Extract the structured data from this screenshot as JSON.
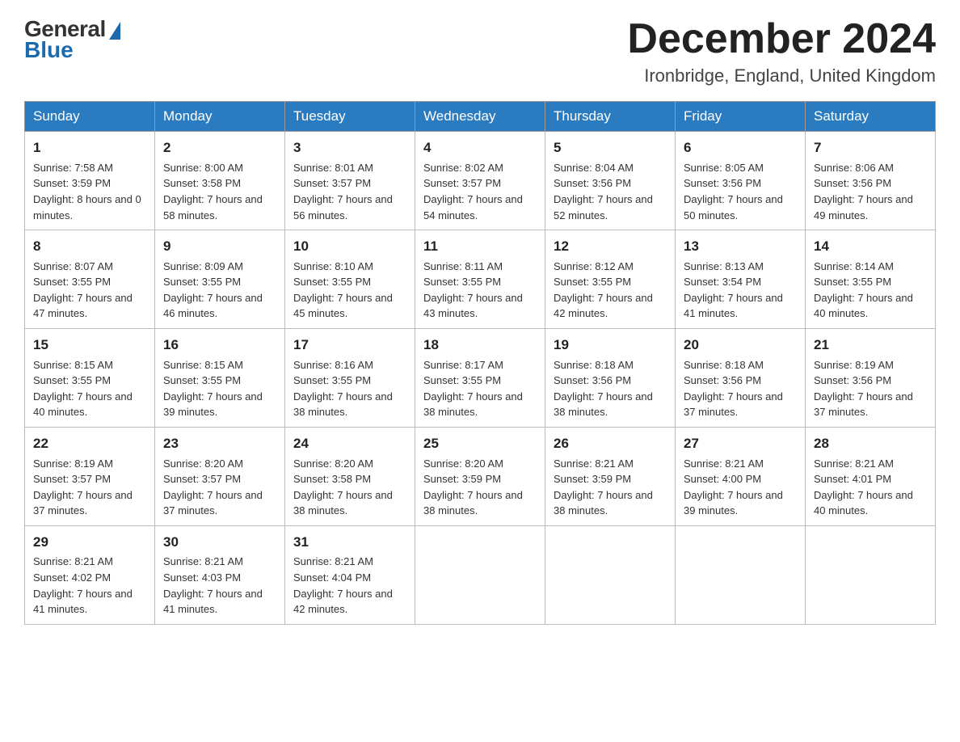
{
  "header": {
    "logo": {
      "general": "General",
      "blue": "Blue"
    },
    "title": "December 2024",
    "location": "Ironbridge, England, United Kingdom"
  },
  "days_of_week": [
    "Sunday",
    "Monday",
    "Tuesday",
    "Wednesday",
    "Thursday",
    "Friday",
    "Saturday"
  ],
  "weeks": [
    [
      {
        "day": "1",
        "sunrise": "7:58 AM",
        "sunset": "3:59 PM",
        "daylight": "8 hours and 0 minutes."
      },
      {
        "day": "2",
        "sunrise": "8:00 AM",
        "sunset": "3:58 PM",
        "daylight": "7 hours and 58 minutes."
      },
      {
        "day": "3",
        "sunrise": "8:01 AM",
        "sunset": "3:57 PM",
        "daylight": "7 hours and 56 minutes."
      },
      {
        "day": "4",
        "sunrise": "8:02 AM",
        "sunset": "3:57 PM",
        "daylight": "7 hours and 54 minutes."
      },
      {
        "day": "5",
        "sunrise": "8:04 AM",
        "sunset": "3:56 PM",
        "daylight": "7 hours and 52 minutes."
      },
      {
        "day": "6",
        "sunrise": "8:05 AM",
        "sunset": "3:56 PM",
        "daylight": "7 hours and 50 minutes."
      },
      {
        "day": "7",
        "sunrise": "8:06 AM",
        "sunset": "3:56 PM",
        "daylight": "7 hours and 49 minutes."
      }
    ],
    [
      {
        "day": "8",
        "sunrise": "8:07 AM",
        "sunset": "3:55 PM",
        "daylight": "7 hours and 47 minutes."
      },
      {
        "day": "9",
        "sunrise": "8:09 AM",
        "sunset": "3:55 PM",
        "daylight": "7 hours and 46 minutes."
      },
      {
        "day": "10",
        "sunrise": "8:10 AM",
        "sunset": "3:55 PM",
        "daylight": "7 hours and 45 minutes."
      },
      {
        "day": "11",
        "sunrise": "8:11 AM",
        "sunset": "3:55 PM",
        "daylight": "7 hours and 43 minutes."
      },
      {
        "day": "12",
        "sunrise": "8:12 AM",
        "sunset": "3:55 PM",
        "daylight": "7 hours and 42 minutes."
      },
      {
        "day": "13",
        "sunrise": "8:13 AM",
        "sunset": "3:54 PM",
        "daylight": "7 hours and 41 minutes."
      },
      {
        "day": "14",
        "sunrise": "8:14 AM",
        "sunset": "3:55 PM",
        "daylight": "7 hours and 40 minutes."
      }
    ],
    [
      {
        "day": "15",
        "sunrise": "8:15 AM",
        "sunset": "3:55 PM",
        "daylight": "7 hours and 40 minutes."
      },
      {
        "day": "16",
        "sunrise": "8:15 AM",
        "sunset": "3:55 PM",
        "daylight": "7 hours and 39 minutes."
      },
      {
        "day": "17",
        "sunrise": "8:16 AM",
        "sunset": "3:55 PM",
        "daylight": "7 hours and 38 minutes."
      },
      {
        "day": "18",
        "sunrise": "8:17 AM",
        "sunset": "3:55 PM",
        "daylight": "7 hours and 38 minutes."
      },
      {
        "day": "19",
        "sunrise": "8:18 AM",
        "sunset": "3:56 PM",
        "daylight": "7 hours and 38 minutes."
      },
      {
        "day": "20",
        "sunrise": "8:18 AM",
        "sunset": "3:56 PM",
        "daylight": "7 hours and 37 minutes."
      },
      {
        "day": "21",
        "sunrise": "8:19 AM",
        "sunset": "3:56 PM",
        "daylight": "7 hours and 37 minutes."
      }
    ],
    [
      {
        "day": "22",
        "sunrise": "8:19 AM",
        "sunset": "3:57 PM",
        "daylight": "7 hours and 37 minutes."
      },
      {
        "day": "23",
        "sunrise": "8:20 AM",
        "sunset": "3:57 PM",
        "daylight": "7 hours and 37 minutes."
      },
      {
        "day": "24",
        "sunrise": "8:20 AM",
        "sunset": "3:58 PM",
        "daylight": "7 hours and 38 minutes."
      },
      {
        "day": "25",
        "sunrise": "8:20 AM",
        "sunset": "3:59 PM",
        "daylight": "7 hours and 38 minutes."
      },
      {
        "day": "26",
        "sunrise": "8:21 AM",
        "sunset": "3:59 PM",
        "daylight": "7 hours and 38 minutes."
      },
      {
        "day": "27",
        "sunrise": "8:21 AM",
        "sunset": "4:00 PM",
        "daylight": "7 hours and 39 minutes."
      },
      {
        "day": "28",
        "sunrise": "8:21 AM",
        "sunset": "4:01 PM",
        "daylight": "7 hours and 40 minutes."
      }
    ],
    [
      {
        "day": "29",
        "sunrise": "8:21 AM",
        "sunset": "4:02 PM",
        "daylight": "7 hours and 41 minutes."
      },
      {
        "day": "30",
        "sunrise": "8:21 AM",
        "sunset": "4:03 PM",
        "daylight": "7 hours and 41 minutes."
      },
      {
        "day": "31",
        "sunrise": "8:21 AM",
        "sunset": "4:04 PM",
        "daylight": "7 hours and 42 minutes."
      },
      null,
      null,
      null,
      null
    ]
  ],
  "labels": {
    "sunrise": "Sunrise: ",
    "sunset": "Sunset: ",
    "daylight": "Daylight: "
  }
}
